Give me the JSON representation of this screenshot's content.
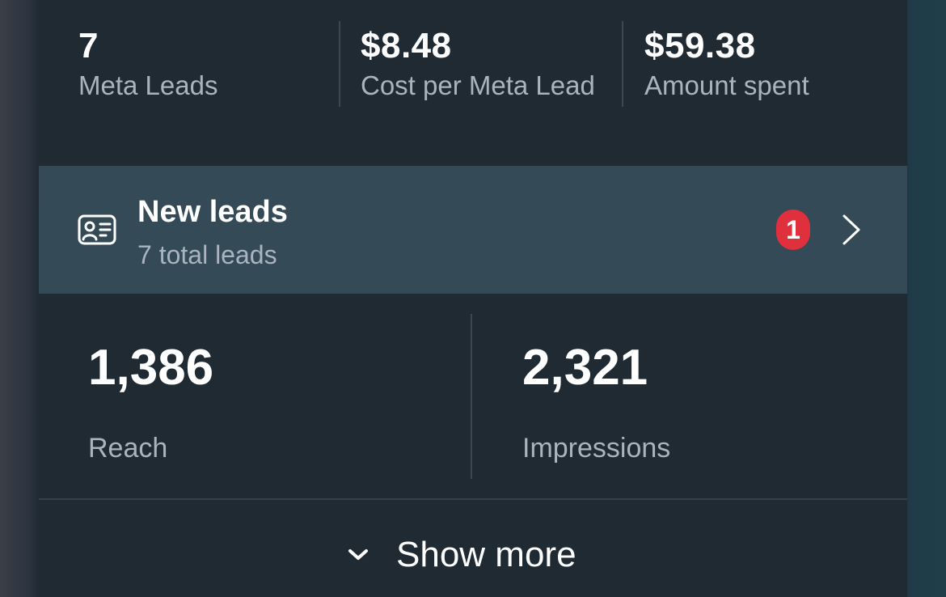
{
  "summary": {
    "leads": {
      "value": "7",
      "label": "Meta Leads"
    },
    "cost_per_lead": {
      "value": "$8.48",
      "label": "Cost per Meta Lead"
    },
    "amount_spent": {
      "value": "$59.38",
      "label": "Amount spent"
    }
  },
  "new_leads": {
    "title": "New leads",
    "subtitle": "7 total leads",
    "badge_count": "1",
    "icon": "contact-card-icon"
  },
  "metrics": {
    "reach": {
      "value": "1,386",
      "label": "Reach"
    },
    "impressions": {
      "value": "2,321",
      "label": "Impressions"
    }
  },
  "show_more": {
    "label": "Show more",
    "icon": "chevron-down-icon"
  },
  "colors": {
    "panel_bg": "#1f2a33",
    "leads_row_bg": "#344a56",
    "badge_bg": "#e0303d",
    "primary_text": "#ffffff",
    "secondary_text": "#aab4bf"
  }
}
